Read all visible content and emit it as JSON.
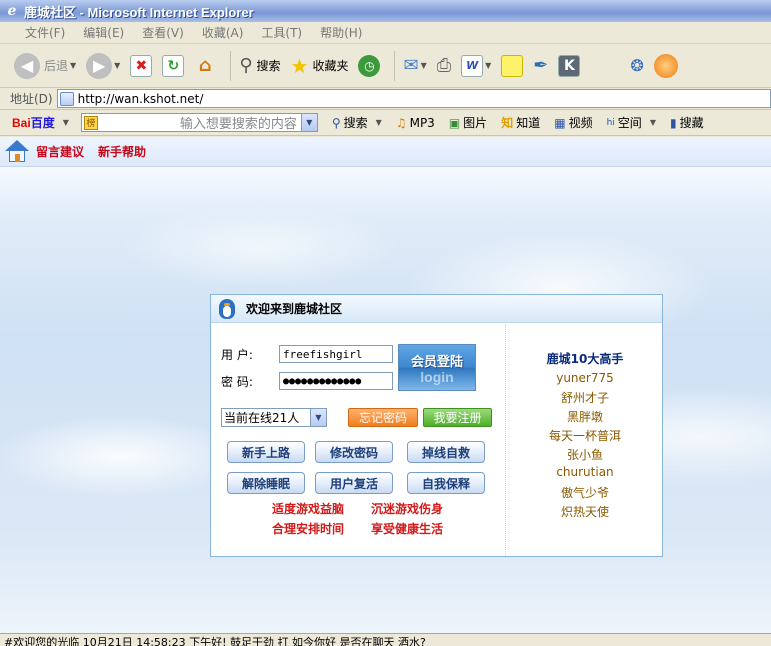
{
  "window": {
    "title": "鹿城社区 - Microsoft Internet Explorer"
  },
  "menubar": {
    "items": [
      "文件(F)",
      "编辑(E)",
      "查看(V)",
      "收藏(A)",
      "工具(T)",
      "帮助(H)"
    ]
  },
  "toolbar": {
    "back_label": "后退",
    "search_label": "搜索",
    "favorites_label": "收藏夹"
  },
  "address": {
    "label": "地址(D)",
    "url": "http://wan.kshot.net/"
  },
  "baidu": {
    "logo_bai": "Bai",
    "logo_du": "百度",
    "search_placeholder": "输入想要搜索的内容",
    "highlight_label": "榜",
    "search_button": "搜索",
    "items": [
      "MP3",
      "图片",
      "知道",
      "视频",
      "空间",
      "搜藏"
    ]
  },
  "page": {
    "top_links": [
      "留言建议",
      "新手帮助"
    ]
  },
  "login": {
    "panel_title": "欢迎来到鹿城社区",
    "username_label": "用  户:",
    "username_value": "freefishgirl",
    "password_label": "密  码:",
    "password_value": "●●●●●●●●●●●●●",
    "login_button_zh": "会员登陆",
    "login_button_en": "login",
    "online_select": "当前在线21人",
    "forgot_password": "忘记密码",
    "register": "我要注册",
    "buttons": [
      "新手上路",
      "修改密码",
      "掉线自救",
      "解除睡眠",
      "用户复活",
      "自我保释"
    ],
    "slogans": [
      "适度游戏益脑",
      "沉迷游戏伤身",
      "合理安排时间",
      "享受健康生活"
    ]
  },
  "top_players": {
    "title": "鹿城10大高手",
    "names": [
      "yuner775",
      "舒州才子",
      "黑胖墩",
      "每天一杯普洱",
      "张小鱼",
      "churutian",
      "傲气少爷",
      "炽热天使"
    ]
  },
  "statusbar": {
    "text": "#欢迎您的光临 10月21日 14:58:23 下午好! 鼓足干劲 打 如今你好 是否在聊天 酒水?"
  },
  "colors": {
    "accent_red": "#c6081a",
    "panel_border": "#89b6de",
    "title_blue": "#0a2a7a"
  }
}
